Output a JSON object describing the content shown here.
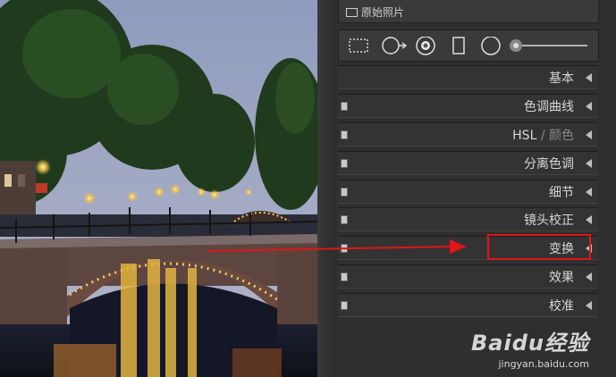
{
  "panel": {
    "original_photo_label": "原始照片",
    "sections": [
      {
        "id": "basic",
        "label": "基本",
        "has_toggle": false,
        "dim_suffix": ""
      },
      {
        "id": "tone-curve",
        "label": "色调曲线",
        "has_toggle": true,
        "dim_suffix": ""
      },
      {
        "id": "hsl",
        "label": "HSL",
        "has_toggle": true,
        "dim_suffix": " / 颜色"
      },
      {
        "id": "split-toning",
        "label": "分离色调",
        "has_toggle": true,
        "dim_suffix": ""
      },
      {
        "id": "detail",
        "label": "细节",
        "has_toggle": true,
        "dim_suffix": ""
      },
      {
        "id": "lens-correction",
        "label": "镜头校正",
        "has_toggle": true,
        "dim_suffix": ""
      },
      {
        "id": "transform",
        "label": "变换",
        "has_toggle": true,
        "dim_suffix": ""
      },
      {
        "id": "effects",
        "label": "效果",
        "has_toggle": true,
        "dim_suffix": ""
      },
      {
        "id": "calibration",
        "label": "校准",
        "has_toggle": true,
        "dim_suffix": ""
      }
    ],
    "tools": [
      "crop-overlay-icon",
      "spot-removal-icon",
      "red-eye-icon",
      "graduated-filter-icon",
      "radial-filter-icon",
      "adjustment-brush-icon"
    ]
  },
  "annotation": {
    "highlight_color": "#e1151a",
    "target_section": "transform"
  },
  "watermark": {
    "brand": "Baidu经验",
    "site": "jingyan.baidu.com"
  }
}
